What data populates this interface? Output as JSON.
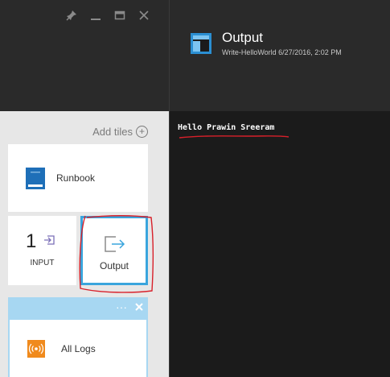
{
  "window": {
    "controls": [
      "pin-icon",
      "minimize-icon",
      "maximize-icon",
      "close-icon"
    ]
  },
  "left_blade": {
    "add_tiles_label": "Add tiles",
    "tiles": {
      "runbook": {
        "label": "Runbook",
        "icon": "runbook-book-icon"
      },
      "input": {
        "count": "1",
        "label": "INPUT",
        "icon": "input-arrow-icon"
      },
      "output": {
        "label": "Output",
        "icon": "output-arrow-icon"
      },
      "all_logs": {
        "label": "All Logs",
        "icon": "logs-broadcast-icon"
      }
    },
    "logs_group_buttons": [
      "more-icon",
      "close-icon"
    ]
  },
  "right_blade": {
    "title": "Output",
    "subtitle": "Write-HelloWorld 6/27/2016, 2:02 PM",
    "icon": "output-blade-icon",
    "output_text": "Hello Prawin Sreeram"
  },
  "colors": {
    "accent": "#3aa5dd",
    "header_bg": "#2a2a2a",
    "console_bg": "#1b1b1b",
    "tiles_bg": "#e7e7e7",
    "runbook_icon": "#1e6fb8",
    "logs_icon": "#f08a1d",
    "annotation": "#d8202a"
  }
}
